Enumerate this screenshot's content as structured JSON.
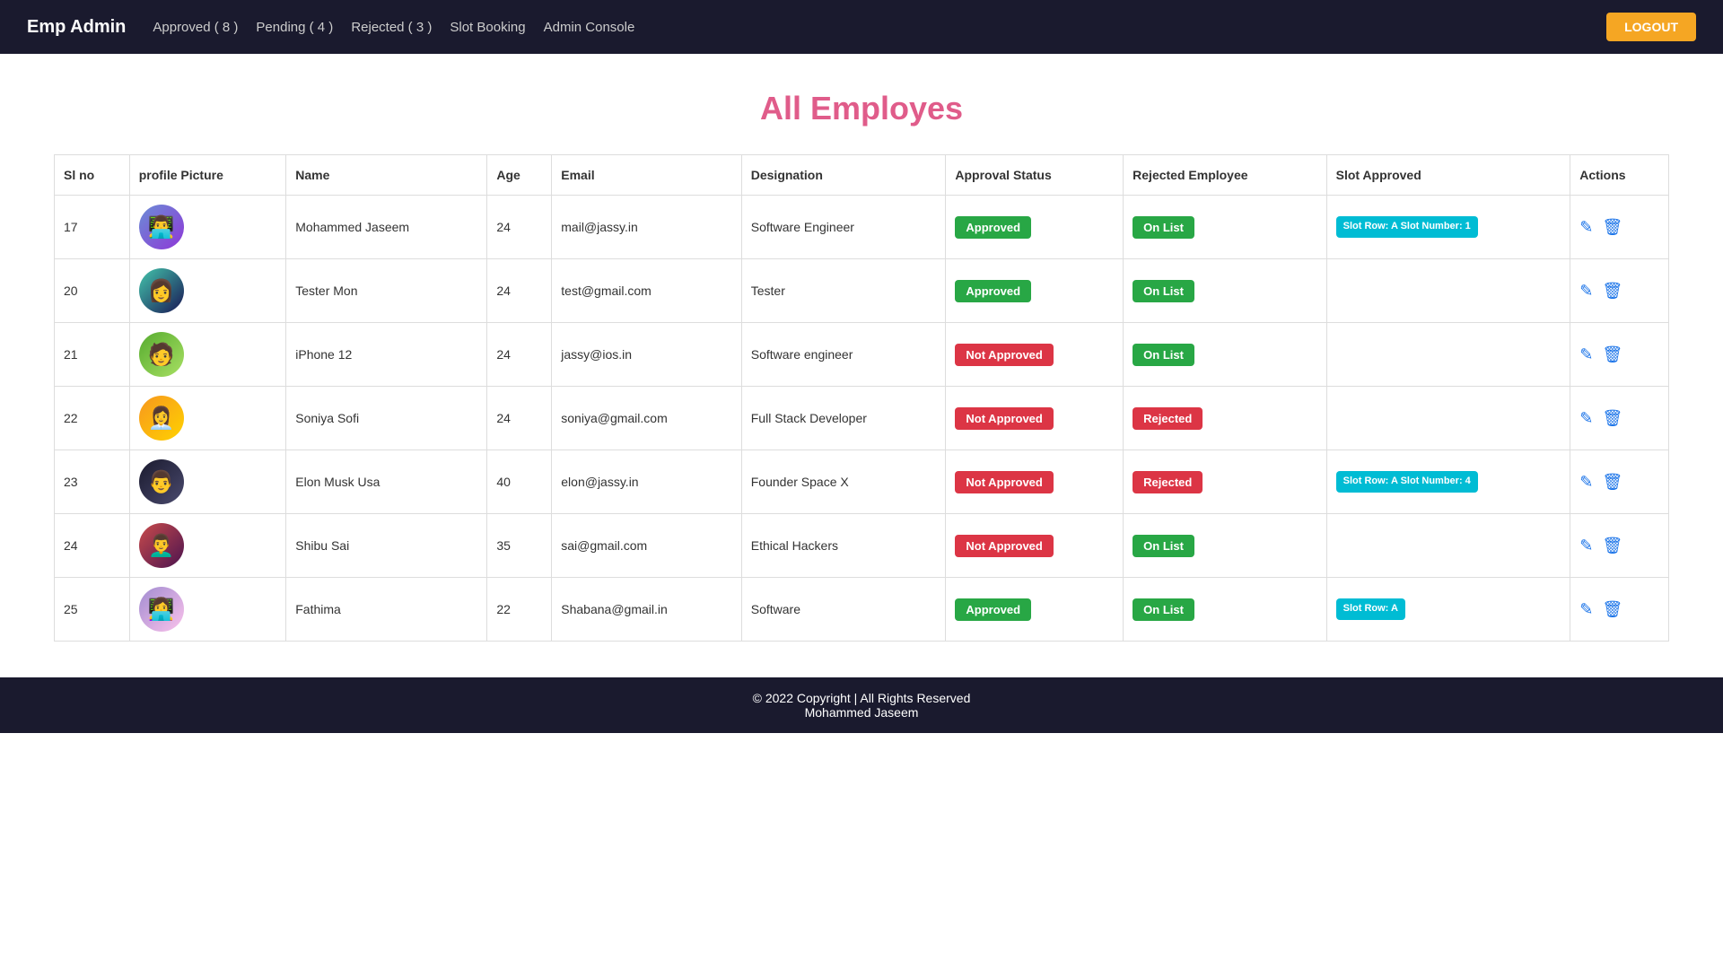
{
  "navbar": {
    "brand": "Emp Admin",
    "links": [
      {
        "label": "Approved ( 8 )",
        "key": "approved"
      },
      {
        "label": "Pending ( 4 )",
        "key": "pending"
      },
      {
        "label": "Rejected ( 3 )",
        "key": "rejected"
      },
      {
        "label": "Slot Booking",
        "key": "slot"
      },
      {
        "label": "Admin Console",
        "key": "admin"
      }
    ],
    "logout_label": "LOGOUT"
  },
  "page": {
    "title": "All Employes"
  },
  "table": {
    "headers": [
      "Sl no",
      "profile Picture",
      "Name",
      "Age",
      "Email",
      "Designation",
      "Approval Status",
      "Rejected Employee",
      "Slot Approved",
      "Actions"
    ],
    "rows": [
      {
        "sl": "17",
        "avatar_class": "avatar-1",
        "avatar_emoji": "👨‍💻",
        "name": "Mohammed Jaseem",
        "age": "24",
        "email": "mail@jassy.in",
        "designation": "Software Engineer",
        "approval_status": "Approved",
        "approval_class": "badge-approved",
        "rejected_status": "On List",
        "rejected_class": "badge-on-list",
        "slot": "Slot Row: A Slot Number: 1",
        "slot_show": true
      },
      {
        "sl": "20",
        "avatar_class": "avatar-2",
        "avatar_emoji": "👩",
        "name": "Tester Mon",
        "age": "24",
        "email": "test@gmail.com",
        "designation": "Tester",
        "approval_status": "Approved",
        "approval_class": "badge-approved",
        "rejected_status": "On List",
        "rejected_class": "badge-on-list",
        "slot": "",
        "slot_show": false
      },
      {
        "sl": "21",
        "avatar_class": "avatar-3",
        "avatar_emoji": "🧑",
        "name": "iPhone 12",
        "age": "24",
        "email": "jassy@ios.in",
        "designation": "Software engineer",
        "approval_status": "Not Approved",
        "approval_class": "badge-not-approved",
        "rejected_status": "On List",
        "rejected_class": "badge-on-list",
        "slot": "",
        "slot_show": false
      },
      {
        "sl": "22",
        "avatar_class": "avatar-4",
        "avatar_emoji": "👩‍💼",
        "name": "Soniya Sofi",
        "age": "24",
        "email": "soniya@gmail.com",
        "designation": "Full Stack Developer",
        "approval_status": "Not Approved",
        "approval_class": "badge-not-approved",
        "rejected_status": "Rejected",
        "rejected_class": "badge-rejected",
        "slot": "",
        "slot_show": false
      },
      {
        "sl": "23",
        "avatar_class": "avatar-5",
        "avatar_emoji": "👨",
        "name": "Elon Musk Usa",
        "age": "40",
        "email": "elon@jassy.in",
        "designation": "Founder Space X",
        "approval_status": "Not Approved",
        "approval_class": "badge-not-approved",
        "rejected_status": "Rejected",
        "rejected_class": "badge-rejected",
        "slot": "Slot Row: A Slot Number: 4",
        "slot_show": true
      },
      {
        "sl": "24",
        "avatar_class": "avatar-6",
        "avatar_emoji": "👨‍🦱",
        "name": "Shibu Sai",
        "age": "35",
        "email": "sai@gmail.com",
        "designation": "Ethical Hackers",
        "approval_status": "Not Approved",
        "approval_class": "badge-not-approved",
        "rejected_status": "On List",
        "rejected_class": "badge-on-list",
        "slot": "",
        "slot_show": false
      },
      {
        "sl": "25",
        "avatar_class": "avatar-7",
        "avatar_emoji": "👩‍💻",
        "name": "Fathima",
        "age": "22",
        "email": "Shabana@gmail.in",
        "designation": "Software",
        "approval_status": "Approved",
        "approval_class": "badge-approved",
        "rejected_status": "On List",
        "rejected_class": "badge-on-list",
        "slot": "Slot Row: A",
        "slot_show": true
      }
    ]
  },
  "footer": {
    "line1": "© 2022 Copyright | All Rights Reserved",
    "line2": "Mohammed Jaseem"
  }
}
